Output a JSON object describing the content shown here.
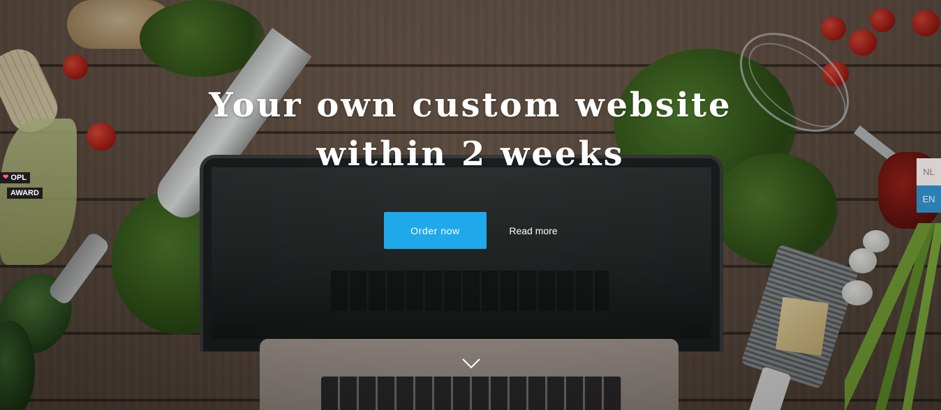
{
  "hero": {
    "headline_line1": "Your own custom website",
    "headline_line2": "within 2 weeks",
    "primary_cta": "Order now",
    "secondary_cta": "Read more",
    "scroll_icon": "chevron-down-icon"
  },
  "award_badge": {
    "icon": "heart-icon",
    "line1": "OPL",
    "line2": "AWARD"
  },
  "language_switcher": {
    "options": [
      {
        "label": "NL",
        "active": false
      },
      {
        "label": "EN",
        "active": true
      }
    ]
  },
  "colors": {
    "accent": "#1fa9ea",
    "language_active": "#2d7eb2",
    "language_inactive": "#d7d2cf",
    "badge_background": "#1d1d1d",
    "badge_heart": "#ff5fa2"
  }
}
